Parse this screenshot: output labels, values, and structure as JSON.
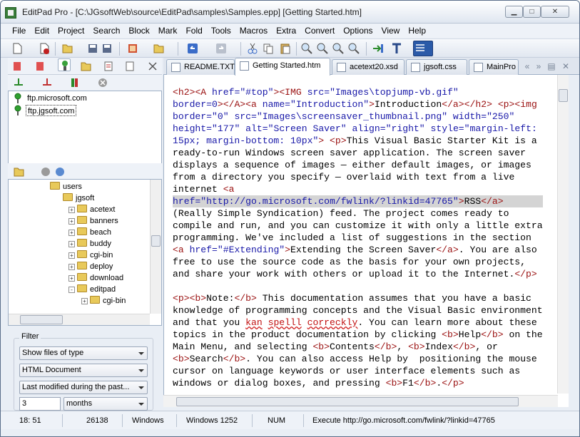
{
  "window": {
    "title": "EditPad Pro - [C:\\JGsoftWeb\\source\\EditPad\\samples\\Samples.epp] [Getting Started.htm]",
    "minimize_label": "▁",
    "maximize_label": "□",
    "close_label": "✕"
  },
  "menu": [
    "File",
    "Edit",
    "Project",
    "Search",
    "Block",
    "Mark",
    "Fold",
    "Tools",
    "Macros",
    "Extra",
    "Convert",
    "Options",
    "View",
    "Help"
  ],
  "ftp": {
    "items": [
      "ftp.microsoft.com",
      "ftp.jgsoft.com"
    ],
    "selected_index": 1
  },
  "file_tree": {
    "items": [
      {
        "label": "users",
        "depth": 0,
        "expander": ""
      },
      {
        "label": "jgsoft",
        "depth": 1,
        "expander": ""
      },
      {
        "label": "acetext",
        "depth": 2,
        "expander": "+"
      },
      {
        "label": "banners",
        "depth": 2,
        "expander": "+"
      },
      {
        "label": "beach",
        "depth": 2,
        "expander": "+"
      },
      {
        "label": "buddy",
        "depth": 2,
        "expander": "+"
      },
      {
        "label": "cgi-bin",
        "depth": 2,
        "expander": "+"
      },
      {
        "label": "deploy",
        "depth": 2,
        "expander": "+"
      },
      {
        "label": "download",
        "depth": 2,
        "expander": "+"
      },
      {
        "label": "editpad",
        "depth": 2,
        "expander": "-"
      },
      {
        "label": "cgi-bin",
        "depth": 3,
        "expander": "+"
      }
    ]
  },
  "filter": {
    "title": "Filter",
    "show_files": "Show files of type",
    "file_type": "HTML Document",
    "modified": "Last modified during the past...",
    "count": "3",
    "unit": "months"
  },
  "tabs": [
    {
      "label": "README.TXT",
      "active": false
    },
    {
      "label": "Getting Started.htm",
      "active": true
    },
    {
      "label": "acetext20.xsd",
      "active": false
    },
    {
      "label": "jgsoft.css",
      "active": false
    },
    {
      "label": "MainPro",
      "active": false
    }
  ],
  "editor_lines": [
    [
      [
        "tag",
        "<h2>"
      ],
      [
        "tag",
        "<A "
      ],
      [
        "attr",
        "href="
      ],
      [
        "str",
        "\"#top\""
      ],
      [
        "tag",
        ">"
      ],
      [
        "tag",
        "<IMG "
      ],
      [
        "attr",
        "src="
      ],
      [
        "str",
        "\"Images\\topjump-vb.gif\""
      ]
    ],
    [
      [
        "attr",
        "border="
      ],
      [
        "str",
        "0"
      ],
      [
        "tag",
        ">"
      ],
      [
        "tag",
        "</A>"
      ],
      [
        "tag",
        "<a "
      ],
      [
        "attr",
        "name="
      ],
      [
        "str",
        "\"Introduction\""
      ],
      [
        "tag",
        ">"
      ],
      [
        "",
        "Introduction"
      ],
      [
        "tag",
        "</a>"
      ],
      [
        "tag",
        "</h2>"
      ],
      [
        "",
        " "
      ],
      [
        "tag",
        "<p>"
      ],
      [
        "tag",
        "<img"
      ]
    ],
    [
      [
        "attr",
        "border="
      ],
      [
        "str",
        "\"0\""
      ],
      [
        "",
        " "
      ],
      [
        "attr",
        "src="
      ],
      [
        "str",
        "\"Images\\screensaver_thumbnail.png\""
      ],
      [
        "",
        " "
      ],
      [
        "attr",
        "width="
      ],
      [
        "str",
        "\"250\""
      ]
    ],
    [
      [
        "attr",
        "height="
      ],
      [
        "str",
        "\"177\""
      ],
      [
        "",
        " "
      ],
      [
        "attr",
        "alt="
      ],
      [
        "str",
        "\"Screen Saver\""
      ],
      [
        "",
        " "
      ],
      [
        "attr",
        "align="
      ],
      [
        "str",
        "\"right\""
      ],
      [
        "",
        " "
      ],
      [
        "attr",
        "style="
      ],
      [
        "str",
        "\"margin-left:"
      ]
    ],
    [
      [
        "str",
        "15px; margin-bottom: 10px\""
      ],
      [
        "tag",
        ">"
      ],
      [
        "",
        " "
      ],
      [
        "tag",
        "<p>"
      ],
      [
        "",
        "This Visual Basic Starter Kit is a"
      ]
    ],
    [
      [
        "",
        "ready-to-run Windows screen saver application. The screen saver"
      ]
    ],
    [
      [
        "",
        "displays a sequence of images — either default images, or images"
      ]
    ],
    [
      [
        "",
        "from a directory you specify — overlaid with text from a live"
      ]
    ],
    [
      [
        "",
        "internet "
      ],
      [
        "tag",
        "<a"
      ]
    ],
    [
      [
        "attr",
        "href="
      ],
      [
        "str",
        "\"http://go.microsoft.com/fwlink/?linkid=47765\""
      ],
      [
        "tag",
        ">"
      ],
      [
        "",
        "RSS"
      ],
      [
        "tag",
        "</a>"
      ]
    ],
    [
      [
        "",
        "(Really Simple Syndication) feed. The project comes ready to"
      ]
    ],
    [
      [
        "",
        "compile and run, and you can customize it with only a little extra"
      ]
    ],
    [
      [
        "",
        "programming. We've included a list of suggestions in the section"
      ]
    ],
    [
      [
        "tag",
        "<a "
      ],
      [
        "attr",
        "href="
      ],
      [
        "str",
        "\"#Extending\""
      ],
      [
        "tag",
        ">"
      ],
      [
        "",
        "Extending the Screen Saver"
      ],
      [
        "tag",
        "</a>"
      ],
      [
        "",
        ". You are also"
      ]
    ],
    [
      [
        "",
        "free to use the source code as the basis for your own projects,"
      ]
    ],
    [
      [
        "",
        "and share your work with others or upload it to the Internet."
      ],
      [
        "tag",
        "</p>"
      ]
    ],
    [
      [
        "",
        ""
      ]
    ],
    [
      [
        "tag",
        "<p>"
      ],
      [
        "tag",
        "<b>"
      ],
      [
        "",
        "Note:"
      ],
      [
        "tag",
        "</b>"
      ],
      [
        "",
        " This documentation assumes that you have a basic"
      ]
    ],
    [
      [
        "",
        "knowledge of programming concepts and the Visual Basic environment"
      ]
    ],
    [
      [
        "",
        "and that you "
      ],
      [
        "sp",
        "kan"
      ],
      [
        "",
        " "
      ],
      [
        "sp",
        "spelll"
      ],
      [
        "",
        " "
      ],
      [
        "sp",
        "correckly"
      ],
      [
        "",
        ". You can learn more about these"
      ]
    ],
    [
      [
        "",
        "topics in the product documentation by clicking "
      ],
      [
        "tag",
        "<b>"
      ],
      [
        "",
        "Help"
      ],
      [
        "tag",
        "</b>"
      ],
      [
        "",
        " on the"
      ]
    ],
    [
      [
        "",
        "Main Menu, and selecting "
      ],
      [
        "tag",
        "<b>"
      ],
      [
        "",
        "Contents"
      ],
      [
        "tag",
        "</b>"
      ],
      [
        "",
        ", "
      ],
      [
        "tag",
        "<b>"
      ],
      [
        "",
        "Index"
      ],
      [
        "tag",
        "</b>"
      ],
      [
        "",
        ", or"
      ]
    ],
    [
      [
        "tag",
        "<b>"
      ],
      [
        "",
        "Search"
      ],
      [
        "tag",
        "</b>"
      ],
      [
        "",
        ". You can also access Help by  positioning the mouse"
      ]
    ],
    [
      [
        "",
        "cursor on language keywords or user interface elements such as"
      ]
    ],
    [
      [
        "",
        "windows or dialog boxes, and pressing "
      ],
      [
        "tag",
        "<b>"
      ],
      [
        "",
        "F1"
      ],
      [
        "tag",
        "</b>"
      ],
      [
        "",
        "."
      ],
      [
        "tag",
        "</p>"
      ]
    ]
  ],
  "highlight_line": 9,
  "status": {
    "position": "18: 51",
    "size": "26138",
    "line_breaks": "Windows",
    "encoding": "Windows 1252",
    "num": "NUM",
    "hint": "Execute http://go.microsoft.com/fwlink/?linkid=47765"
  },
  "colors": {
    "tag": "#9a1010",
    "attr": "#1818a8",
    "spelling": "#c01010",
    "highlight": "#d4d4d4"
  }
}
